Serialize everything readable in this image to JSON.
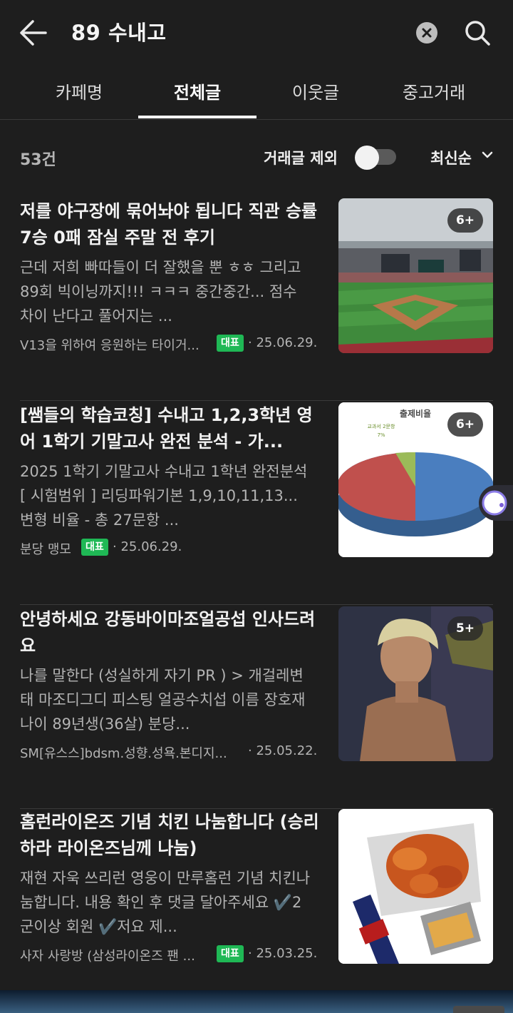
{
  "header": {
    "search_query": "89 수내고",
    "back_icon": "arrow-left-icon",
    "clear_icon": "clear-circle-icon",
    "search_icon": "search-icon"
  },
  "tabs": [
    {
      "label": "카페명",
      "active": false
    },
    {
      "label": "전체글",
      "active": true
    },
    {
      "label": "이웃글",
      "active": false
    },
    {
      "label": "중고거래",
      "active": false
    }
  ],
  "filter": {
    "count": "53건",
    "exclude_trade_label": "거래글 제외",
    "exclude_trade_on": false,
    "sort_label": "최신순"
  },
  "posts": [
    {
      "title": "저를 야구장에 묶어놔야 됩니다 직관 승률 7승 0패 잠실 주말 전 후기",
      "snippet": "근데 저희 빠따들이 더 잘했을 뿐 ㅎㅎ 그리고 89회 빅이닝까지!!! ㅋㅋㅋ 중간중간... 점수 차이 난다고 풀어지는 ...",
      "author": "V13을 위하여 응원하는 타이거...",
      "badge": "대표",
      "date": "· 25.06.29.",
      "image_count": "6+"
    },
    {
      "title": "[쌤들의 학습코칭] 수내고 1,2,3학년 영어 1학기 기말고사 완전 분석 - 가...",
      "snippet": "2025 1학기 기말고사 수내고 1학년 완전분석 [ 시험범위 ] 리딩파워기본 1,9,10,11,13... 변형 비율 - 총 27문항 ...",
      "author": "분당 맹모",
      "badge": "대표",
      "date": "· 25.06.29.",
      "image_count": "6+",
      "image_texts": {
        "chart_title": "출제비율",
        "slice_label": "교과서 2문항",
        "slice_pct": "7%"
      }
    },
    {
      "title": "안녕하세요 강동바이마조얼공섭 인사드려요",
      "snippet": "나를 말한다 (성실하게 자기 PR ) > 개걸레변태 마조디그디 피스팅 얼공수치섭 이름 장호재 나이 89년생(36살) 분당...",
      "author": "SM[유스스]bdsm.성향.성욕.본디지...",
      "badge": "",
      "date": "· 25.05.22.",
      "image_count": "5+"
    },
    {
      "title": "홈런라이온즈 기념 치킨 나눔합니다 (승리하라 라이온즈님께 나눔)",
      "snippet": "재현 자욱 쓰리런 영웅이 만루홈런 기념 치킨나눔합니다. 내용 확인 후 댓글 달아주세요 ✔️2군이상 회원 ✔️저요 제...",
      "author": "사자 사랑방 (삼성라이온즈 팬 ...",
      "badge": "대표",
      "date": "· 25.03.25.",
      "image_count": ""
    }
  ]
}
